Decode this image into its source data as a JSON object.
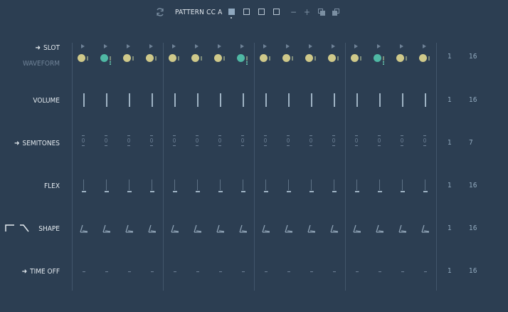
{
  "toolbar": {
    "pattern_label": "PATTERN CC A",
    "icons": [
      "refresh-icon",
      "pattern-1",
      "pattern-2",
      "pattern-3",
      "pattern-4",
      "minus-icon",
      "plus-icon",
      "copy-icon",
      "paste-icon"
    ],
    "minus_glyph": "−",
    "plus_glyph": "+"
  },
  "rows": {
    "slot": "SLOT",
    "waveform": "WAVEFORM",
    "volume": "VOLUME",
    "semitones": "SEMITONES",
    "flex": "FLEX",
    "shape": "SHAPE",
    "time_off": "TIME OFF"
  },
  "slot_colors": [
    "yellow",
    "teal",
    "yellow",
    "yellow",
    "yellow",
    "yellow",
    "yellow",
    "teal",
    "yellow",
    "yellow",
    "yellow",
    "yellow",
    "yellow",
    "teal",
    "yellow",
    "yellow"
  ],
  "semitone_values": [
    "0",
    "0",
    "0",
    "0",
    "0",
    "0",
    "0",
    "0",
    "0",
    "0",
    "0",
    "0",
    "0",
    "0",
    "0",
    "0"
  ],
  "ranges": {
    "slot": {
      "min": "1",
      "max": "16"
    },
    "volume": {
      "min": "1",
      "max": "16"
    },
    "semitones": {
      "min": "1",
      "max": "7"
    },
    "flex": {
      "min": "1",
      "max": "16"
    },
    "shape": {
      "min": "1",
      "max": "16"
    },
    "time_off": {
      "min": "1",
      "max": "16"
    }
  },
  "colors": {
    "background": "#2c3e52",
    "yellow": "#cfc98a",
    "teal": "#4fb8a4",
    "bar": "#9fb3c4"
  }
}
